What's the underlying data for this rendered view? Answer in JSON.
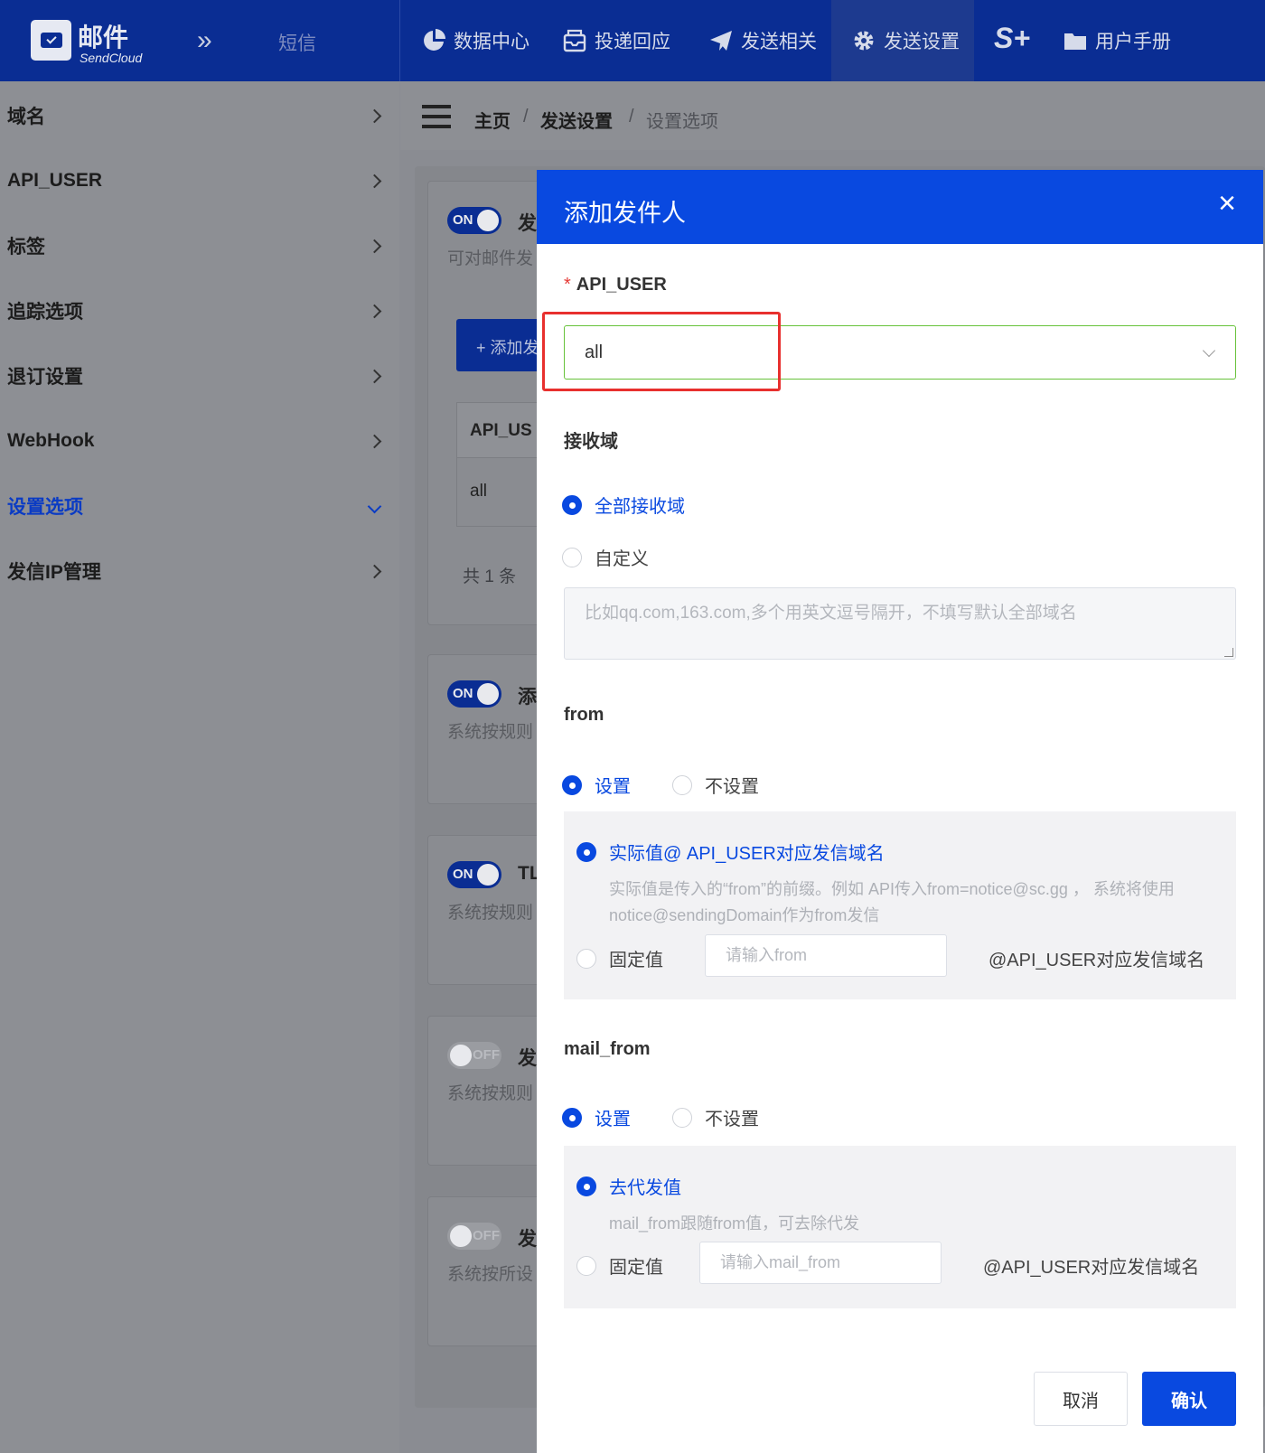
{
  "header": {
    "logo_title": "邮件",
    "logo_sub": "SendCloud",
    "sms": "短信",
    "nav": [
      {
        "label": "数据中心",
        "icon": "pie-chart-icon"
      },
      {
        "label": "投递回应",
        "icon": "inbox-icon"
      },
      {
        "label": "发送相关",
        "icon": "send-icon"
      },
      {
        "label": "发送设置",
        "icon": "gear-icon"
      },
      {
        "label": "用户手册",
        "icon": "folder-icon"
      }
    ],
    "splus": "S+"
  },
  "sidebar": {
    "items": [
      {
        "label": "域名"
      },
      {
        "label": "API_USER"
      },
      {
        "label": "标签"
      },
      {
        "label": "追踪选项"
      },
      {
        "label": "退订设置"
      },
      {
        "label": "WebHook"
      },
      {
        "label": "设置选项"
      },
      {
        "label": "发信IP管理"
      }
    ],
    "active_index": 6
  },
  "breadcrumb": {
    "home": "主页",
    "sep": "/",
    "section": "发送设置",
    "current": "设置选项"
  },
  "background": {
    "cards": [
      {
        "toggle": "ON",
        "title": "发",
        "desc": "可对邮件发"
      },
      {
        "toggle": "ON",
        "title": "添",
        "desc": "系统按规则"
      },
      {
        "toggle": "ON",
        "title": "TL",
        "desc": "系统按规则"
      },
      {
        "toggle": "OFF",
        "title": "发",
        "desc": "系统按规则"
      },
      {
        "toggle": "OFF",
        "title": "发",
        "desc": "系统按所设"
      }
    ],
    "add_button": "+ 添加发",
    "table_header": "API_US",
    "table_cell": "all",
    "total": "共 1 条"
  },
  "modal": {
    "title": "添加发件人",
    "close": "×",
    "api_user": {
      "required_mark": "*",
      "label": "API_USER",
      "value": "all"
    },
    "recv_domain": {
      "label": "接收域",
      "option_all": "全部接收域",
      "option_custom": "自定义",
      "placeholder": "比如qq.com,163.com,多个用英文逗号隔开，不填写默认全部域名"
    },
    "from": {
      "label": "from",
      "set": "设置",
      "unset": "不设置",
      "actual": "实际值@ API_USER对应发信域名",
      "hint": "实际值是传入的“from”的前缀。例如 API传入from=notice@sc.gg ， 系统将使用notice@sendingDomain作为from发信",
      "fixed": "固定值",
      "placeholder": "请输入from",
      "suffix": "@API_USER对应发信域名"
    },
    "mail_from": {
      "label": "mail_from",
      "set": "设置",
      "unset": "不设置",
      "remove": "去代发值",
      "hint": "mail_from跟随from值，可去除代发",
      "fixed": "固定值",
      "placeholder": "请输入mail_from",
      "suffix": "@API_USER对应发信域名"
    },
    "cancel": "取消",
    "confirm": "确认"
  },
  "colors": {
    "nav_bg": "#0a2d93",
    "modal_header": "#0949e0",
    "highlight": "#e8302e",
    "select_border": "#67c23a"
  }
}
